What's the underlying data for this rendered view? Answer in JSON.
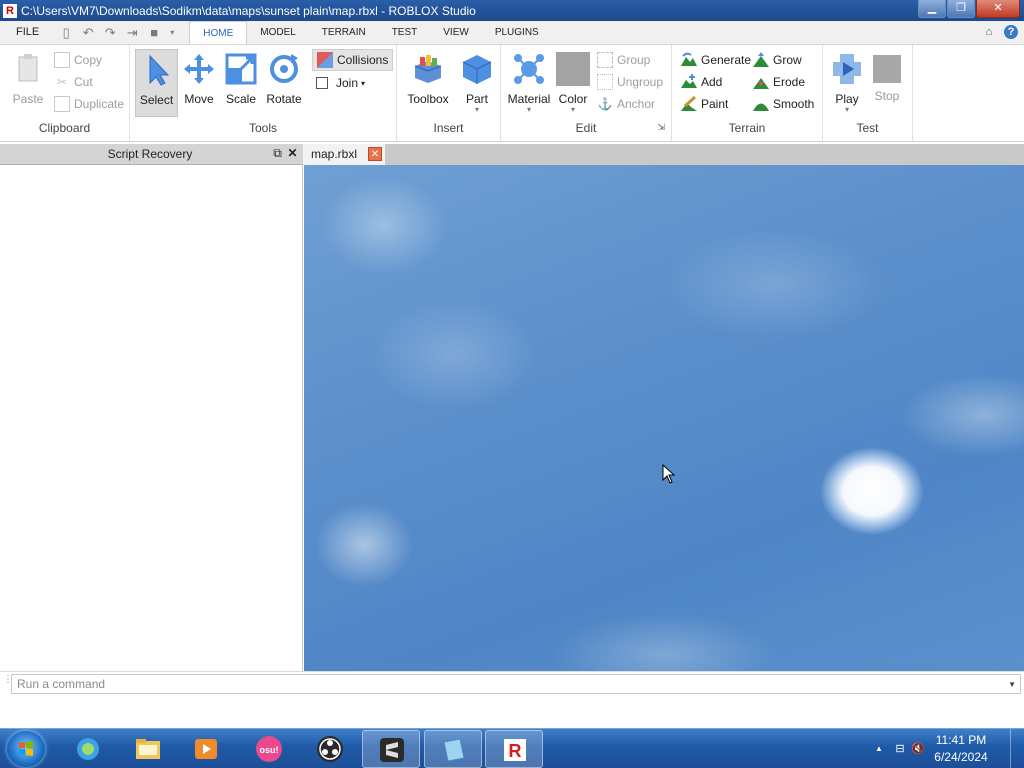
{
  "window": {
    "title": "C:\\Users\\VM7\\Downloads\\Sodikm\\data\\maps\\sunset plain\\map.rbxl - ROBLOX Studio",
    "minimize": "▁",
    "maximize": "❐",
    "close": "✕"
  },
  "ribbon_tabs": [
    "FILE",
    "HOME",
    "MODEL",
    "TERRAIN",
    "TEST",
    "VIEW",
    "PLUGINS"
  ],
  "active_tab": "HOME",
  "ribbon": {
    "clipboard": {
      "label": "Clipboard",
      "paste": "Paste",
      "copy": "Copy",
      "cut": "Cut",
      "duplicate": "Duplicate"
    },
    "tools": {
      "label": "Tools",
      "select": "Select",
      "move": "Move",
      "scale": "Scale",
      "rotate": "Rotate",
      "collisions": "Collisions",
      "join": "Join"
    },
    "insert": {
      "label": "Insert",
      "toolbox": "Toolbox",
      "part": "Part"
    },
    "edit": {
      "label": "Edit",
      "material": "Material",
      "color": "Color",
      "group": "Group",
      "ungroup": "Ungroup",
      "anchor": "Anchor"
    },
    "terrain": {
      "label": "Terrain",
      "generate": "Generate",
      "add": "Add",
      "paint": "Paint",
      "grow": "Grow",
      "erode": "Erode",
      "smooth": "Smooth"
    },
    "test": {
      "label": "Test",
      "play": "Play",
      "stop": "Stop"
    }
  },
  "left_panel": {
    "title": "Script Recovery"
  },
  "document_tab": {
    "label": "map.rbxl"
  },
  "command_bar": {
    "placeholder": "Run a command",
    "value": ""
  },
  "taskbar": {
    "clock_time": "11:41 PM",
    "clock_date": "6/24/2024"
  },
  "colors": {
    "titlebar": "#1c4a8c",
    "accent_tab": "#2c64b8",
    "sky": "#5b8fcb",
    "taskbar": "#1f5aa8"
  }
}
